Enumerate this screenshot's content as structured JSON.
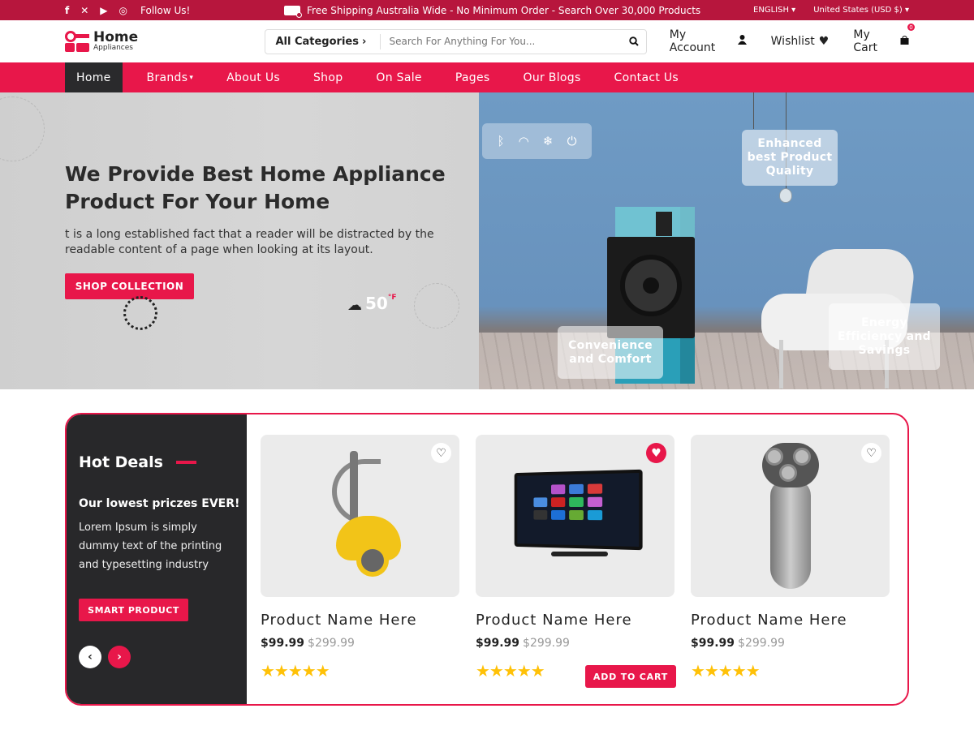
{
  "topbar": {
    "follow_text": "Follow Us!",
    "shipping": "Free Shipping Australia Wide - No Minimum Order - Search Over 30,000 Products",
    "language": "ENGLISH",
    "currency": "United States (USD $)"
  },
  "header": {
    "logo_title": "Home",
    "logo_subtitle": "Appliances",
    "search_category": "All Categories",
    "search_placeholder": "Search For Anything For You...",
    "account": "My Account",
    "wishlist": "Wishlist",
    "cart": "My Cart",
    "cart_count": "0"
  },
  "nav": [
    "Home",
    "Brands",
    "About Us",
    "Shop",
    "On Sale",
    "Pages",
    "Our Blogs",
    "Contact Us"
  ],
  "hero": {
    "title": "We Provide Best Home Appliance Product For Your Home",
    "description": "t is a long established fact that a reader will be distracted by the readable content of a page when looking at its layout.",
    "button": "SHOP COLLECTION",
    "weather_temp": "50",
    "weather_unit": "°F",
    "badge_quality": "Enhanced best Product Quality",
    "badge_comfort": "Convenience and Comfort",
    "badge_energy": "Energy Efficiency and Savings"
  },
  "deals": {
    "title": "Hot Deals",
    "subtitle": "Our lowest priczes EVER!",
    "description": "Lorem Ipsum is simply dummy text of the printing and typesetting industry",
    "button": "SMART PRODUCT",
    "add_to_cart": "ADD TO CART",
    "products": [
      {
        "name": "Product Name Here",
        "price": "$99.99",
        "old_price": "$299.99",
        "rating": 5,
        "wishlisted": false
      },
      {
        "name": "Product Name Here",
        "price": "$99.99",
        "old_price": "$299.99",
        "rating": 5,
        "wishlisted": true
      },
      {
        "name": "Product Name Here",
        "price": "$99.99",
        "old_price": "$299.99",
        "rating": 5,
        "wishlisted": false
      }
    ]
  },
  "colors": {
    "brand": "#e8174a",
    "topbar": "#b7163d",
    "dark": "#28282a"
  }
}
